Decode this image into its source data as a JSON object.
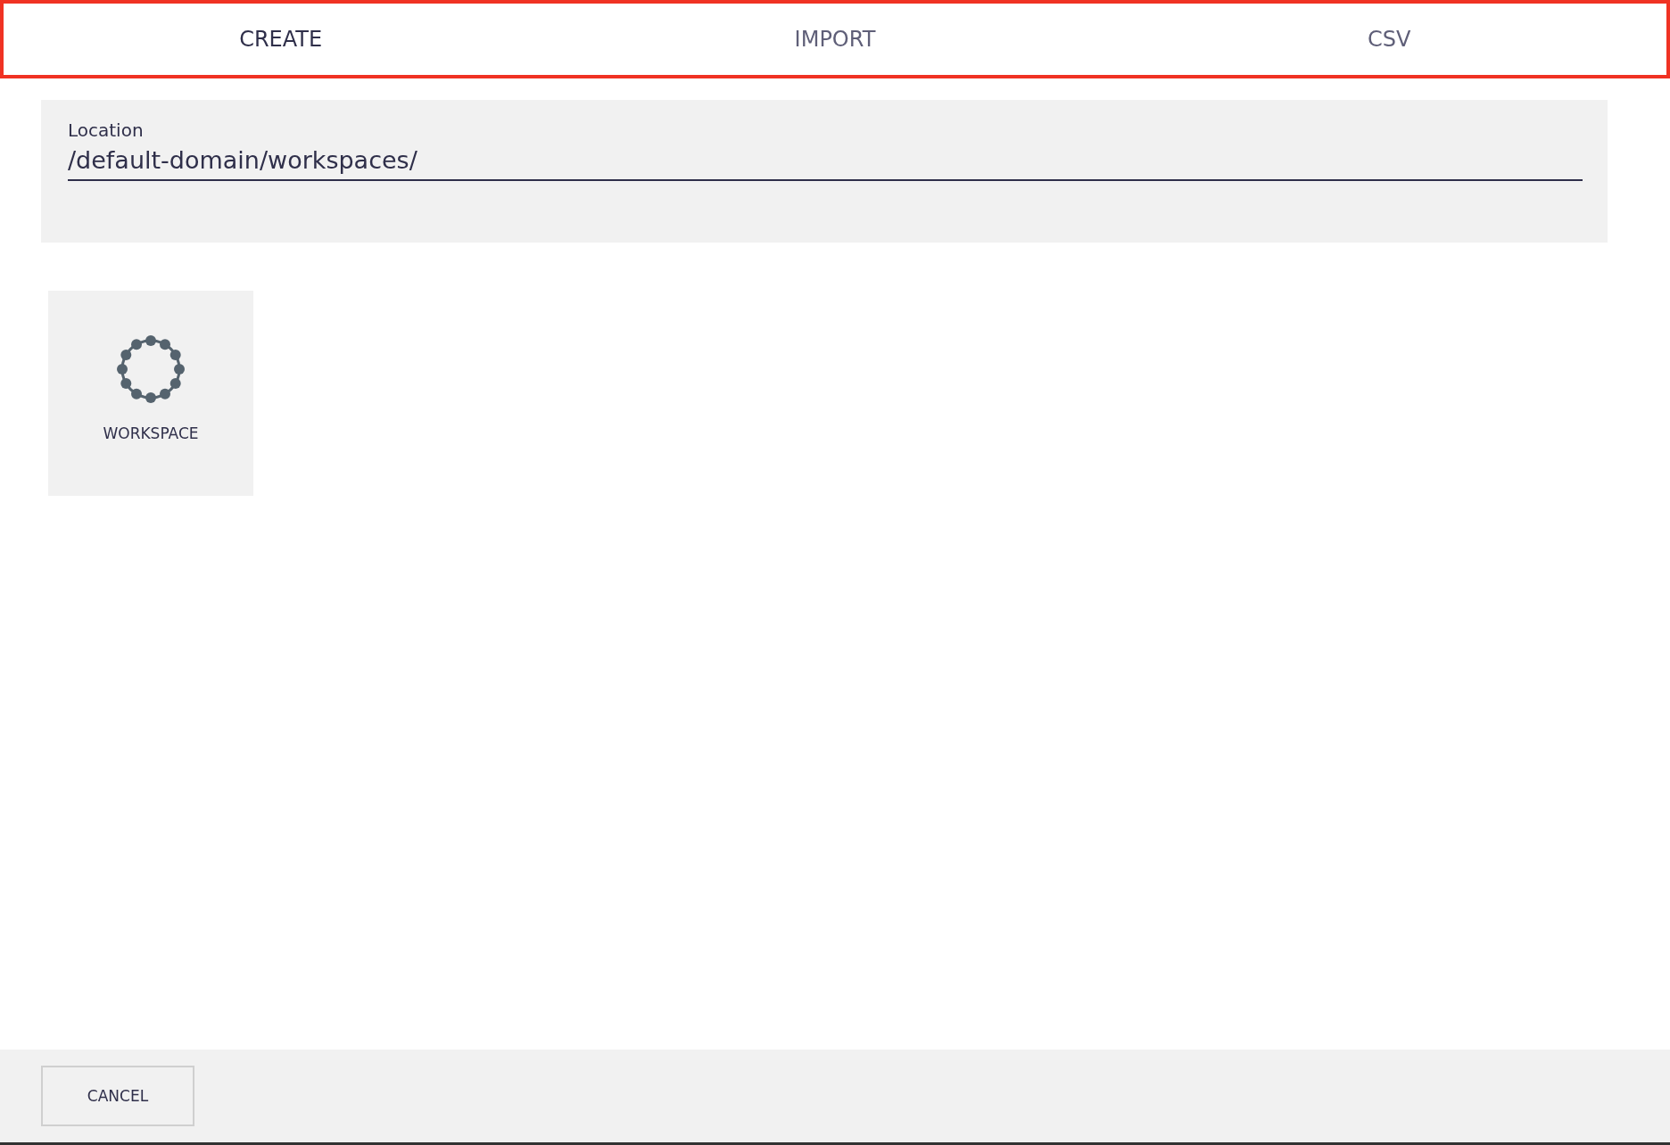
{
  "tab_bar": {
    "highlighted": true,
    "tabs": [
      {
        "label": "CREATE",
        "selected": true
      },
      {
        "label": "IMPORT",
        "selected": false
      },
      {
        "label": "CSV",
        "selected": false
      }
    ]
  },
  "location": {
    "label": "Location",
    "value": "/default-domain/workspaces/"
  },
  "types": [
    {
      "label": "WORKSPACE"
    }
  ],
  "buttons": [
    "CANCEL"
  ]
}
